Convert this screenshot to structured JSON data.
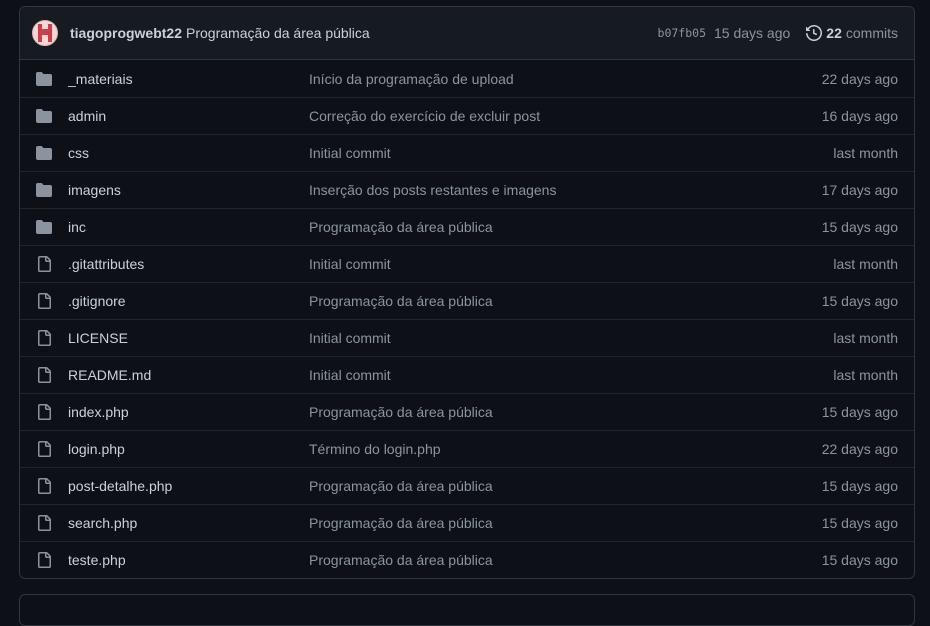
{
  "latest_commit": {
    "author": "tiagoprogwebt22",
    "message": "Programação da área pública",
    "sha": "b07fb05",
    "age": "15 days ago",
    "commits_count": "22",
    "commits_label": "commits"
  },
  "files": [
    {
      "name": "_materiais",
      "type": "folder",
      "message": "Início da programação de upload",
      "age": "22 days ago"
    },
    {
      "name": "admin",
      "type": "folder",
      "message": "Correção do exercício de excluir post",
      "age": "16 days ago"
    },
    {
      "name": "css",
      "type": "folder",
      "message": "Initial commit",
      "age": "last month"
    },
    {
      "name": "imagens",
      "type": "folder",
      "message": "Inserção dos posts restantes e imagens",
      "age": "17 days ago"
    },
    {
      "name": "inc",
      "type": "folder",
      "message": "Programação da área pública",
      "age": "15 days ago"
    },
    {
      "name": ".gitattributes",
      "type": "file",
      "message": "Initial commit",
      "age": "last month"
    },
    {
      "name": ".gitignore",
      "type": "file",
      "message": "Programação da área pública",
      "age": "15 days ago"
    },
    {
      "name": "LICENSE",
      "type": "file",
      "message": "Initial commit",
      "age": "last month"
    },
    {
      "name": "README.md",
      "type": "file",
      "message": "Initial commit",
      "age": "last month"
    },
    {
      "name": "index.php",
      "type": "file",
      "message": "Programação da área pública",
      "age": "15 days ago"
    },
    {
      "name": "login.php",
      "type": "file",
      "message": "Término do login.php",
      "age": "22 days ago"
    },
    {
      "name": "post-detalhe.php",
      "type": "file",
      "message": "Programação da área pública",
      "age": "15 days ago"
    },
    {
      "name": "search.php",
      "type": "file",
      "message": "Programação da área pública",
      "age": "15 days ago"
    },
    {
      "name": "teste.php",
      "type": "file",
      "message": "Programação da área pública",
      "age": "15 days ago"
    }
  ],
  "colors": {
    "folder_icon": "#8b949e",
    "file_icon": "#8b949e",
    "background": "#0d1117",
    "header_bg": "#161b22",
    "border": "#30363d"
  }
}
